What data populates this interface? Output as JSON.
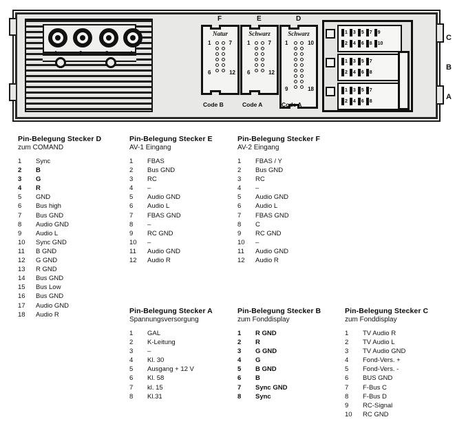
{
  "diagram": {
    "rca_jacks": [
      "1",
      "2",
      "3",
      "4"
    ],
    "side_labels": [
      "C",
      "B",
      "A"
    ],
    "connectors": [
      {
        "letter": "F",
        "color": "Natur",
        "code": "Code B",
        "rows": 6,
        "corner_labels": [
          "1",
          "7",
          "6",
          "12"
        ]
      },
      {
        "letter": "E",
        "color": "Schwarz",
        "code": "Code A",
        "rows": 6,
        "corner_labels": [
          "1",
          "7",
          "6",
          "12"
        ]
      },
      {
        "letter": "D",
        "color": "Schwarz",
        "code": "Code A",
        "rows": 9,
        "corner_labels": [
          "1",
          "10",
          "9",
          "18"
        ]
      }
    ],
    "chambers": [
      {
        "letter": "C",
        "top_row": [
          "1",
          "3",
          "5",
          "7",
          "9"
        ],
        "bottom_row": [
          "2",
          "4",
          "6",
          "8",
          "10"
        ]
      },
      {
        "letter": "B",
        "top_row": [
          "1",
          "3",
          "5",
          "7"
        ],
        "bottom_row": [
          "2",
          "4",
          "6",
          "8"
        ]
      },
      {
        "letter": "A",
        "top_row": [
          "1",
          "3",
          "5",
          "7"
        ],
        "bottom_row": [
          "2",
          "4",
          "6",
          "8"
        ]
      }
    ]
  },
  "blocks": {
    "stecker_d": {
      "title": "Pin-Belegung Stecker D",
      "subtitle": "zum COMAND",
      "pins": [
        {
          "n": "1",
          "v": "Sync",
          "bold": false
        },
        {
          "n": "2",
          "v": "B",
          "bold": true
        },
        {
          "n": "3",
          "v": "G",
          "bold": true
        },
        {
          "n": "4",
          "v": "R",
          "bold": true
        },
        {
          "n": "5",
          "v": "GND",
          "bold": false
        },
        {
          "n": "6",
          "v": "Bus high",
          "bold": false
        },
        {
          "n": "7",
          "v": "Bus GND",
          "bold": false
        },
        {
          "n": "8",
          "v": "Audio GND",
          "bold": false
        },
        {
          "n": "9",
          "v": "Audio L",
          "bold": false
        },
        {
          "n": "10",
          "v": "Sync GND",
          "bold": false
        },
        {
          "n": "11",
          "v": "B GND",
          "bold": false
        },
        {
          "n": "12",
          "v": "G GND",
          "bold": false
        },
        {
          "n": "13",
          "v": "R GND",
          "bold": false
        },
        {
          "n": "14",
          "v": "Bus GND",
          "bold": false
        },
        {
          "n": "15",
          "v": "Bus Low",
          "bold": false
        },
        {
          "n": "16",
          "v": "Bus GND",
          "bold": false
        },
        {
          "n": "17",
          "v": "Audio GND",
          "bold": false
        },
        {
          "n": "18",
          "v": "Audio R",
          "bold": false
        }
      ]
    },
    "stecker_e": {
      "title": "Pin-Belegung Stecker E",
      "subtitle": "AV-1 Eingang",
      "pins": [
        {
          "n": "1",
          "v": "FBAS",
          "bold": false
        },
        {
          "n": "2",
          "v": "Bus GND",
          "bold": false
        },
        {
          "n": "3",
          "v": "RC",
          "bold": false
        },
        {
          "n": "4",
          "v": "–",
          "bold": false
        },
        {
          "n": "5",
          "v": "Audio GND",
          "bold": false
        },
        {
          "n": "6",
          "v": "Audio L",
          "bold": false
        },
        {
          "n": "7",
          "v": "FBAS GND",
          "bold": false
        },
        {
          "n": "8",
          "v": "–",
          "bold": false
        },
        {
          "n": "9",
          "v": "RC GND",
          "bold": false
        },
        {
          "n": "10",
          "v": "–",
          "bold": false
        },
        {
          "n": "11",
          "v": "Audio GND",
          "bold": false
        },
        {
          "n": "12",
          "v": "Audio R",
          "bold": false
        }
      ]
    },
    "stecker_f": {
      "title": "Pin-Belegung Stecker F",
      "subtitle": "AV-2 Eingang",
      "pins": [
        {
          "n": "1",
          "v": "FBAS / Y",
          "bold": false
        },
        {
          "n": "2",
          "v": "Bus GND",
          "bold": false
        },
        {
          "n": "3",
          "v": "RC",
          "bold": false
        },
        {
          "n": "4",
          "v": "–",
          "bold": false
        },
        {
          "n": "5",
          "v": "Audio GND",
          "bold": false
        },
        {
          "n": "6",
          "v": "Audio L",
          "bold": false
        },
        {
          "n": "7",
          "v": "FBAS GND",
          "bold": false
        },
        {
          "n": "8",
          "v": "C",
          "bold": false
        },
        {
          "n": "9",
          "v": "RC GND",
          "bold": false
        },
        {
          "n": "10",
          "v": "–",
          "bold": false
        },
        {
          "n": "11",
          "v": "Audio GND",
          "bold": false
        },
        {
          "n": "12",
          "v": "Audio R",
          "bold": false
        }
      ]
    },
    "stecker_a": {
      "title": "Pin-Belegung Stecker A",
      "subtitle": "Spannungsversorgung",
      "pins": [
        {
          "n": "1",
          "v": "GAL",
          "bold": false
        },
        {
          "n": "2",
          "v": "K-Leitung",
          "bold": false
        },
        {
          "n": "3",
          "v": "–",
          "bold": false
        },
        {
          "n": "4",
          "v": "Kl. 30",
          "bold": false
        },
        {
          "n": "5",
          "v": "Ausgang + 12 V",
          "bold": false
        },
        {
          "n": "6",
          "v": "Kl. 58",
          "bold": false
        },
        {
          "n": "7",
          "v": "kl. 15",
          "bold": false
        },
        {
          "n": "8",
          "v": "Kl.31",
          "bold": false
        }
      ]
    },
    "stecker_b": {
      "title": "Pin-Belegung Stecker B",
      "subtitle": "zum Fonddisplay",
      "pins": [
        {
          "n": "1",
          "v": "R GND",
          "bold": true
        },
        {
          "n": "2",
          "v": "R",
          "bold": true
        },
        {
          "n": "3",
          "v": "G GND",
          "bold": true
        },
        {
          "n": "4",
          "v": "G",
          "bold": true
        },
        {
          "n": "5",
          "v": "B GND",
          "bold": true
        },
        {
          "n": "6",
          "v": "B",
          "bold": true
        },
        {
          "n": "7",
          "v": "Sync GND",
          "bold": true
        },
        {
          "n": "8",
          "v": "Sync",
          "bold": true
        }
      ]
    },
    "stecker_c": {
      "title": "Pin-Belegung Stecker C",
      "subtitle": "zum Fonddisplay",
      "pins": [
        {
          "n": "1",
          "v": "TV Audio R",
          "bold": false
        },
        {
          "n": "2",
          "v": "TV Audio L",
          "bold": false
        },
        {
          "n": "3",
          "v": "TV Audio GND",
          "bold": false
        },
        {
          "n": "4",
          "v": "Fond-Vers. +",
          "bold": false
        },
        {
          "n": "5",
          "v": "Fond-Vers. -",
          "bold": false
        },
        {
          "n": "6",
          "v": "BUS GND",
          "bold": false
        },
        {
          "n": "7",
          "v": "F-Bus C",
          "bold": false
        },
        {
          "n": "8",
          "v": "F-Bus D",
          "bold": false
        },
        {
          "n": "9",
          "v": "RC-Signal",
          "bold": false
        },
        {
          "n": "10",
          "v": "RC GND",
          "bold": false
        }
      ]
    }
  }
}
